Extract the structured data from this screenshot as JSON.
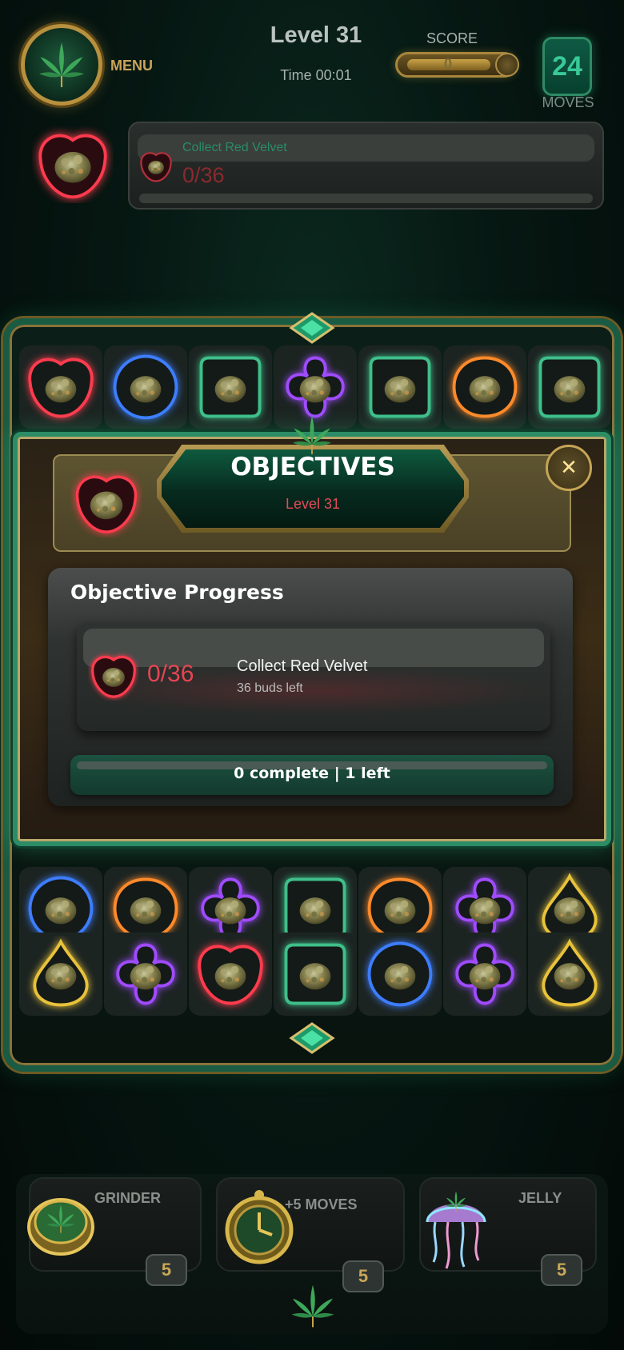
{
  "header": {
    "menu_label": "MENU",
    "level_title": "Level 31",
    "time_label": "Time 00:01",
    "score_label": "SCORE",
    "score_value": "0",
    "moves_value": "24",
    "moves_label": "MOVES"
  },
  "top_objective": {
    "name": "Collect Red Velvet",
    "count": "0/36"
  },
  "board": {
    "row_top": [
      "red",
      "blue",
      "green",
      "purple",
      "green",
      "orange",
      "green"
    ],
    "row_3": [
      "blue",
      "orange",
      "purple",
      "green",
      "orange",
      "purple",
      "yellow"
    ],
    "row_4": [
      "yellow",
      "purple",
      "red",
      "green",
      "blue",
      "purple",
      "yellow"
    ]
  },
  "modal": {
    "title": "OBJECTIVES",
    "subtitle": "Level 31",
    "close_icon": "close-icon",
    "progress_title": "Objective Progress",
    "objective": {
      "count": "0/36",
      "name": "Collect Red Velvet",
      "remaining": "36 buds left"
    },
    "summary": "0 complete | 1 left"
  },
  "boosters": [
    {
      "label": "GRINDER",
      "count": "5",
      "icon": "grinder-icon"
    },
    {
      "label": "+5 MOVES",
      "count": "5",
      "icon": "clock-icon"
    },
    {
      "label": "JELLY",
      "count": "5",
      "icon": "jellyfish-icon"
    }
  ],
  "colors": {
    "red": "#ff3b4e",
    "blue": "#3d7dff",
    "green": "#3fbf8a",
    "purple": "#a04bff",
    "orange": "#ff8a2a",
    "yellow": "#e8c23a",
    "gold": "#c9a45a"
  }
}
